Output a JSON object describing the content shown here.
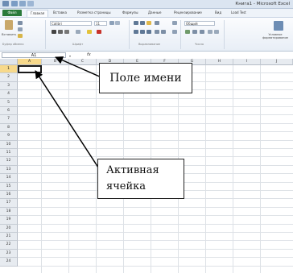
{
  "app": {
    "title": "Книга1 - Microsoft Excel"
  },
  "ribbon_tabs": [
    "Файл",
    "Главная",
    "Вставка",
    "Разметка страницы",
    "Формулы",
    "Данные",
    "Рецензирование",
    "Вид",
    "Load Test"
  ],
  "ribbon": {
    "paste_label": "Вставить",
    "font_name": "Calibri",
    "font_size": "11",
    "number_format": "Общий",
    "conditional_label": "Условное форматирование",
    "groups": [
      "Буфер обмена",
      "Шрифт",
      "Выравнивание",
      "Число"
    ]
  },
  "formula_bar": {
    "name_box": "A1",
    "fx": "fx"
  },
  "columns": [
    "A",
    "B",
    "C",
    "D",
    "E",
    "F",
    "G",
    "H",
    "I",
    "J"
  ],
  "rows": [
    "1",
    "2",
    "3",
    "4",
    "5",
    "6",
    "7",
    "8",
    "9",
    "10",
    "11",
    "12",
    "13",
    "14",
    "15",
    "16",
    "17",
    "18",
    "19",
    "20",
    "21",
    "22",
    "23",
    "24"
  ],
  "callouts": {
    "name_box": "Поле имени",
    "active_cell_line1": "Активная",
    "active_cell_line2": "ячейка"
  }
}
